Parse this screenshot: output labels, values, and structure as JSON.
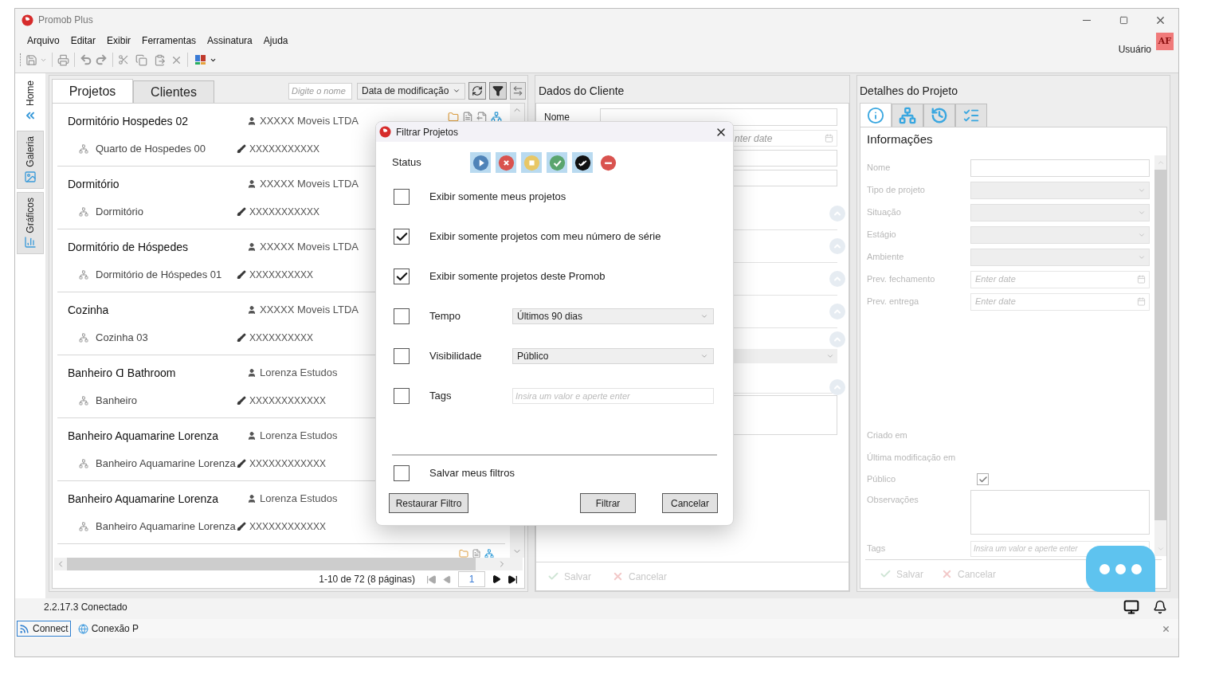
{
  "window": {
    "title": "Promob Plus"
  },
  "menu": [
    "Arquivo",
    "Editar",
    "Exibir",
    "Ferramentas",
    "Assinatura",
    "Ajuda"
  ],
  "user": {
    "label": "Usuário",
    "badge": "AF"
  },
  "sidebar_tabs": [
    {
      "label": "Home",
      "kind": "home",
      "selected": true
    },
    {
      "label": "Galeria",
      "kind": "gallery",
      "selected": false
    },
    {
      "label": "Gráficos",
      "kind": "charts",
      "selected": false
    }
  ],
  "projects_panel": {
    "tabs": [
      {
        "label": "Projetos",
        "selected": true
      },
      {
        "label": "Clientes",
        "selected": false
      }
    ],
    "search": {
      "placeholder": "Digite o nome"
    },
    "sort": "Data de modificação",
    "items": [
      {
        "title": "Dormitório Hospedes 02",
        "client": "XXXXX Moveis LTDA",
        "room": "Quarto de Hospedes 00",
        "author": "XXXXXXXXXXX"
      },
      {
        "title": "Dormitório",
        "client": "XXXXX Moveis LTDA",
        "room": "Dormitório",
        "author": "XXXXXXXXXXX"
      },
      {
        "title": "Dormitório de Hóspedes",
        "client": "XXXXX Moveis LTDA",
        "room": "Dormitório de Hóspedes 01",
        "author": "XXXXXXXXXX"
      },
      {
        "title": "Cozinha",
        "client": "XXXXX Moveis LTDA",
        "room": "Cozinha 03",
        "author": "XXXXXXXXXX"
      },
      {
        "title": "Banheiro ꓷ Bathroom",
        "client": "Lorenza Estudos",
        "room": "Banheiro",
        "author": "XXXXXXXXXXXX"
      },
      {
        "title": "Banheiro Aquamarine Lorenza",
        "client": "Lorenza Estudos",
        "room": "Banheiro Aquamarine Lorenza",
        "author": "XXXXXXXXXXXX"
      },
      {
        "title": "Banheiro Aquamarine Lorenza",
        "client": "Lorenza Estudos",
        "room": "Banheiro Aquamarine Lorenza",
        "author": "XXXXXXXXXXXX"
      }
    ],
    "pagination": {
      "summary": "1-10 de 72 (8 páginas)",
      "page": "1"
    }
  },
  "client_panel": {
    "title": "Dados do Cliente",
    "name_label": "Nome",
    "date_placeholder": "nter date",
    "buttons": [
      {
        "label": "Salvar",
        "kind": "save",
        "disabled": true
      },
      {
        "label": "Cancelar",
        "kind": "cancel",
        "disabled": true
      }
    ]
  },
  "details_panel": {
    "title": "Detalhes do Projeto",
    "tabs": [
      {
        "kind": "info",
        "selected": true
      },
      {
        "kind": "structure",
        "selected": false
      },
      {
        "kind": "history",
        "selected": false
      },
      {
        "kind": "checklist",
        "selected": false
      }
    ],
    "section": "Informações",
    "fields": [
      {
        "label": "Nome",
        "kind": "text"
      },
      {
        "label": "Tipo de projeto",
        "kind": "select"
      },
      {
        "label": "Situação",
        "kind": "select"
      },
      {
        "label": "Estágio",
        "kind": "select"
      },
      {
        "label": "Ambiente",
        "kind": "select"
      },
      {
        "label": "Prev. fechamento",
        "kind": "date",
        "placeholder": "Enter date"
      },
      {
        "label": "Prev. entrega",
        "kind": "date",
        "placeholder": "Enter date"
      }
    ],
    "meta": [
      "Criado em",
      "Última modificação em"
    ],
    "public": {
      "label": "Público",
      "checked": true
    },
    "notes_label": "Observações",
    "tags": {
      "label": "Tags",
      "placeholder": "Insira um valor e aperte enter"
    },
    "buttons": [
      {
        "label": "Salvar",
        "kind": "save",
        "disabled": true
      },
      {
        "label": "Cancelar",
        "kind": "cancel",
        "disabled": true
      }
    ]
  },
  "status_bar": {
    "text": "2.2.17.3 Conectado"
  },
  "connections": [
    {
      "label": "Connect",
      "kind": "connect",
      "selected": true
    },
    {
      "label": "Conexão P",
      "kind": "globe",
      "selected": false
    }
  ],
  "dialog": {
    "title": "Filtrar Projetos",
    "status_label": "Status",
    "status_filters": [
      {
        "kind": "play",
        "selected": true
      },
      {
        "kind": "cancel",
        "selected": true
      },
      {
        "kind": "stop",
        "selected": true
      },
      {
        "kind": "done",
        "selected": true
      },
      {
        "kind": "approved",
        "selected": true
      },
      {
        "kind": "blocked",
        "selected": false
      }
    ],
    "options": [
      {
        "label": "Exibir somente meus projetos",
        "checked": false
      },
      {
        "label": "Exibir somente projetos com meu número de série",
        "checked": true
      },
      {
        "label": "Exibir somente projetos deste Promob",
        "checked": true
      }
    ],
    "time": {
      "label": "Tempo",
      "checked": false,
      "value": "Últimos 90 dias"
    },
    "visibility": {
      "label": "Visibilidade",
      "checked": false,
      "value": "Público"
    },
    "tags": {
      "label": "Tags",
      "checked": false,
      "placeholder": "Insira um valor e aperte enter"
    },
    "save": {
      "label": "Salvar meus filtros",
      "checked": false
    },
    "buttons": [
      {
        "label": "Restaurar Filtro",
        "kind": "reset"
      },
      {
        "label": "Filtrar",
        "kind": "apply"
      },
      {
        "label": "Cancelar",
        "kind": "cancel"
      }
    ]
  }
}
